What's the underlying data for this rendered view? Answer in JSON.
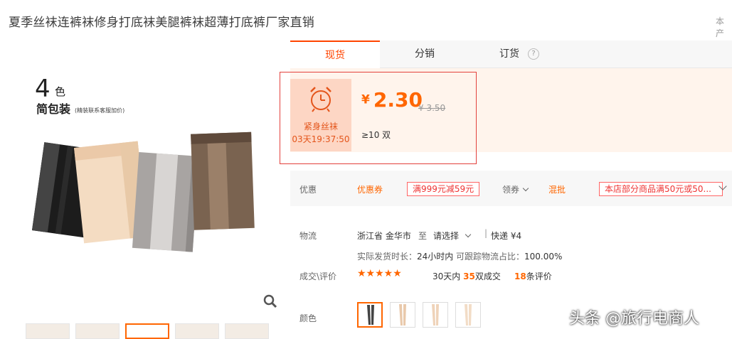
{
  "title": "夏季丝袜连裤袜修身打底袜美腿裤袜超薄打底裤厂家直销",
  "corner_text": "本产",
  "image": {
    "big_num": "4",
    "color_char": "色",
    "pack": "简包装",
    "note": "(精装联系客服加价)"
  },
  "tabs": [
    {
      "label": "现货"
    },
    {
      "label": "分销"
    },
    {
      "label": "订货"
    }
  ],
  "help_icon": "?",
  "promo": {
    "name": "紧身丝袜",
    "countdown": "03天19:37:50",
    "icon": "alarm-clock-icon"
  },
  "price": {
    "currency": "¥",
    "value": "2.30",
    "original": "¥ 3.50"
  },
  "moq": "≥10 双",
  "discount": {
    "label": "优惠",
    "coupon_label": "优惠券",
    "coupon_value": "满999元减59元",
    "get_coupon": "领券",
    "mix_label": "混批",
    "mix_value": "本店部分商品满50元或50..."
  },
  "logistics": {
    "label": "物流",
    "origin": "浙江省 金华市",
    "to": "至",
    "dest": "请选择",
    "express": "快递 ¥4",
    "ship_time_label": "实际发货时长：",
    "ship_time": "24小时内",
    "trace_label": "可跟踪物流占比：",
    "trace": "100.00%"
  },
  "deals": {
    "label": "成交\\评价",
    "stars": "★★★★★",
    "rating": 5,
    "days": "30天内",
    "sold_num": "35",
    "sold_unit": "双成交",
    "reviews_num": "18",
    "reviews_unit": "条评价"
  },
  "color_label": "颜色",
  "watermark": "头条 @旅行电商人",
  "colors": {
    "accent": "#ff6600",
    "red_box": "#e3413c",
    "promo_bg": "#fdd6c4",
    "price_bg": "#fff4ec"
  }
}
